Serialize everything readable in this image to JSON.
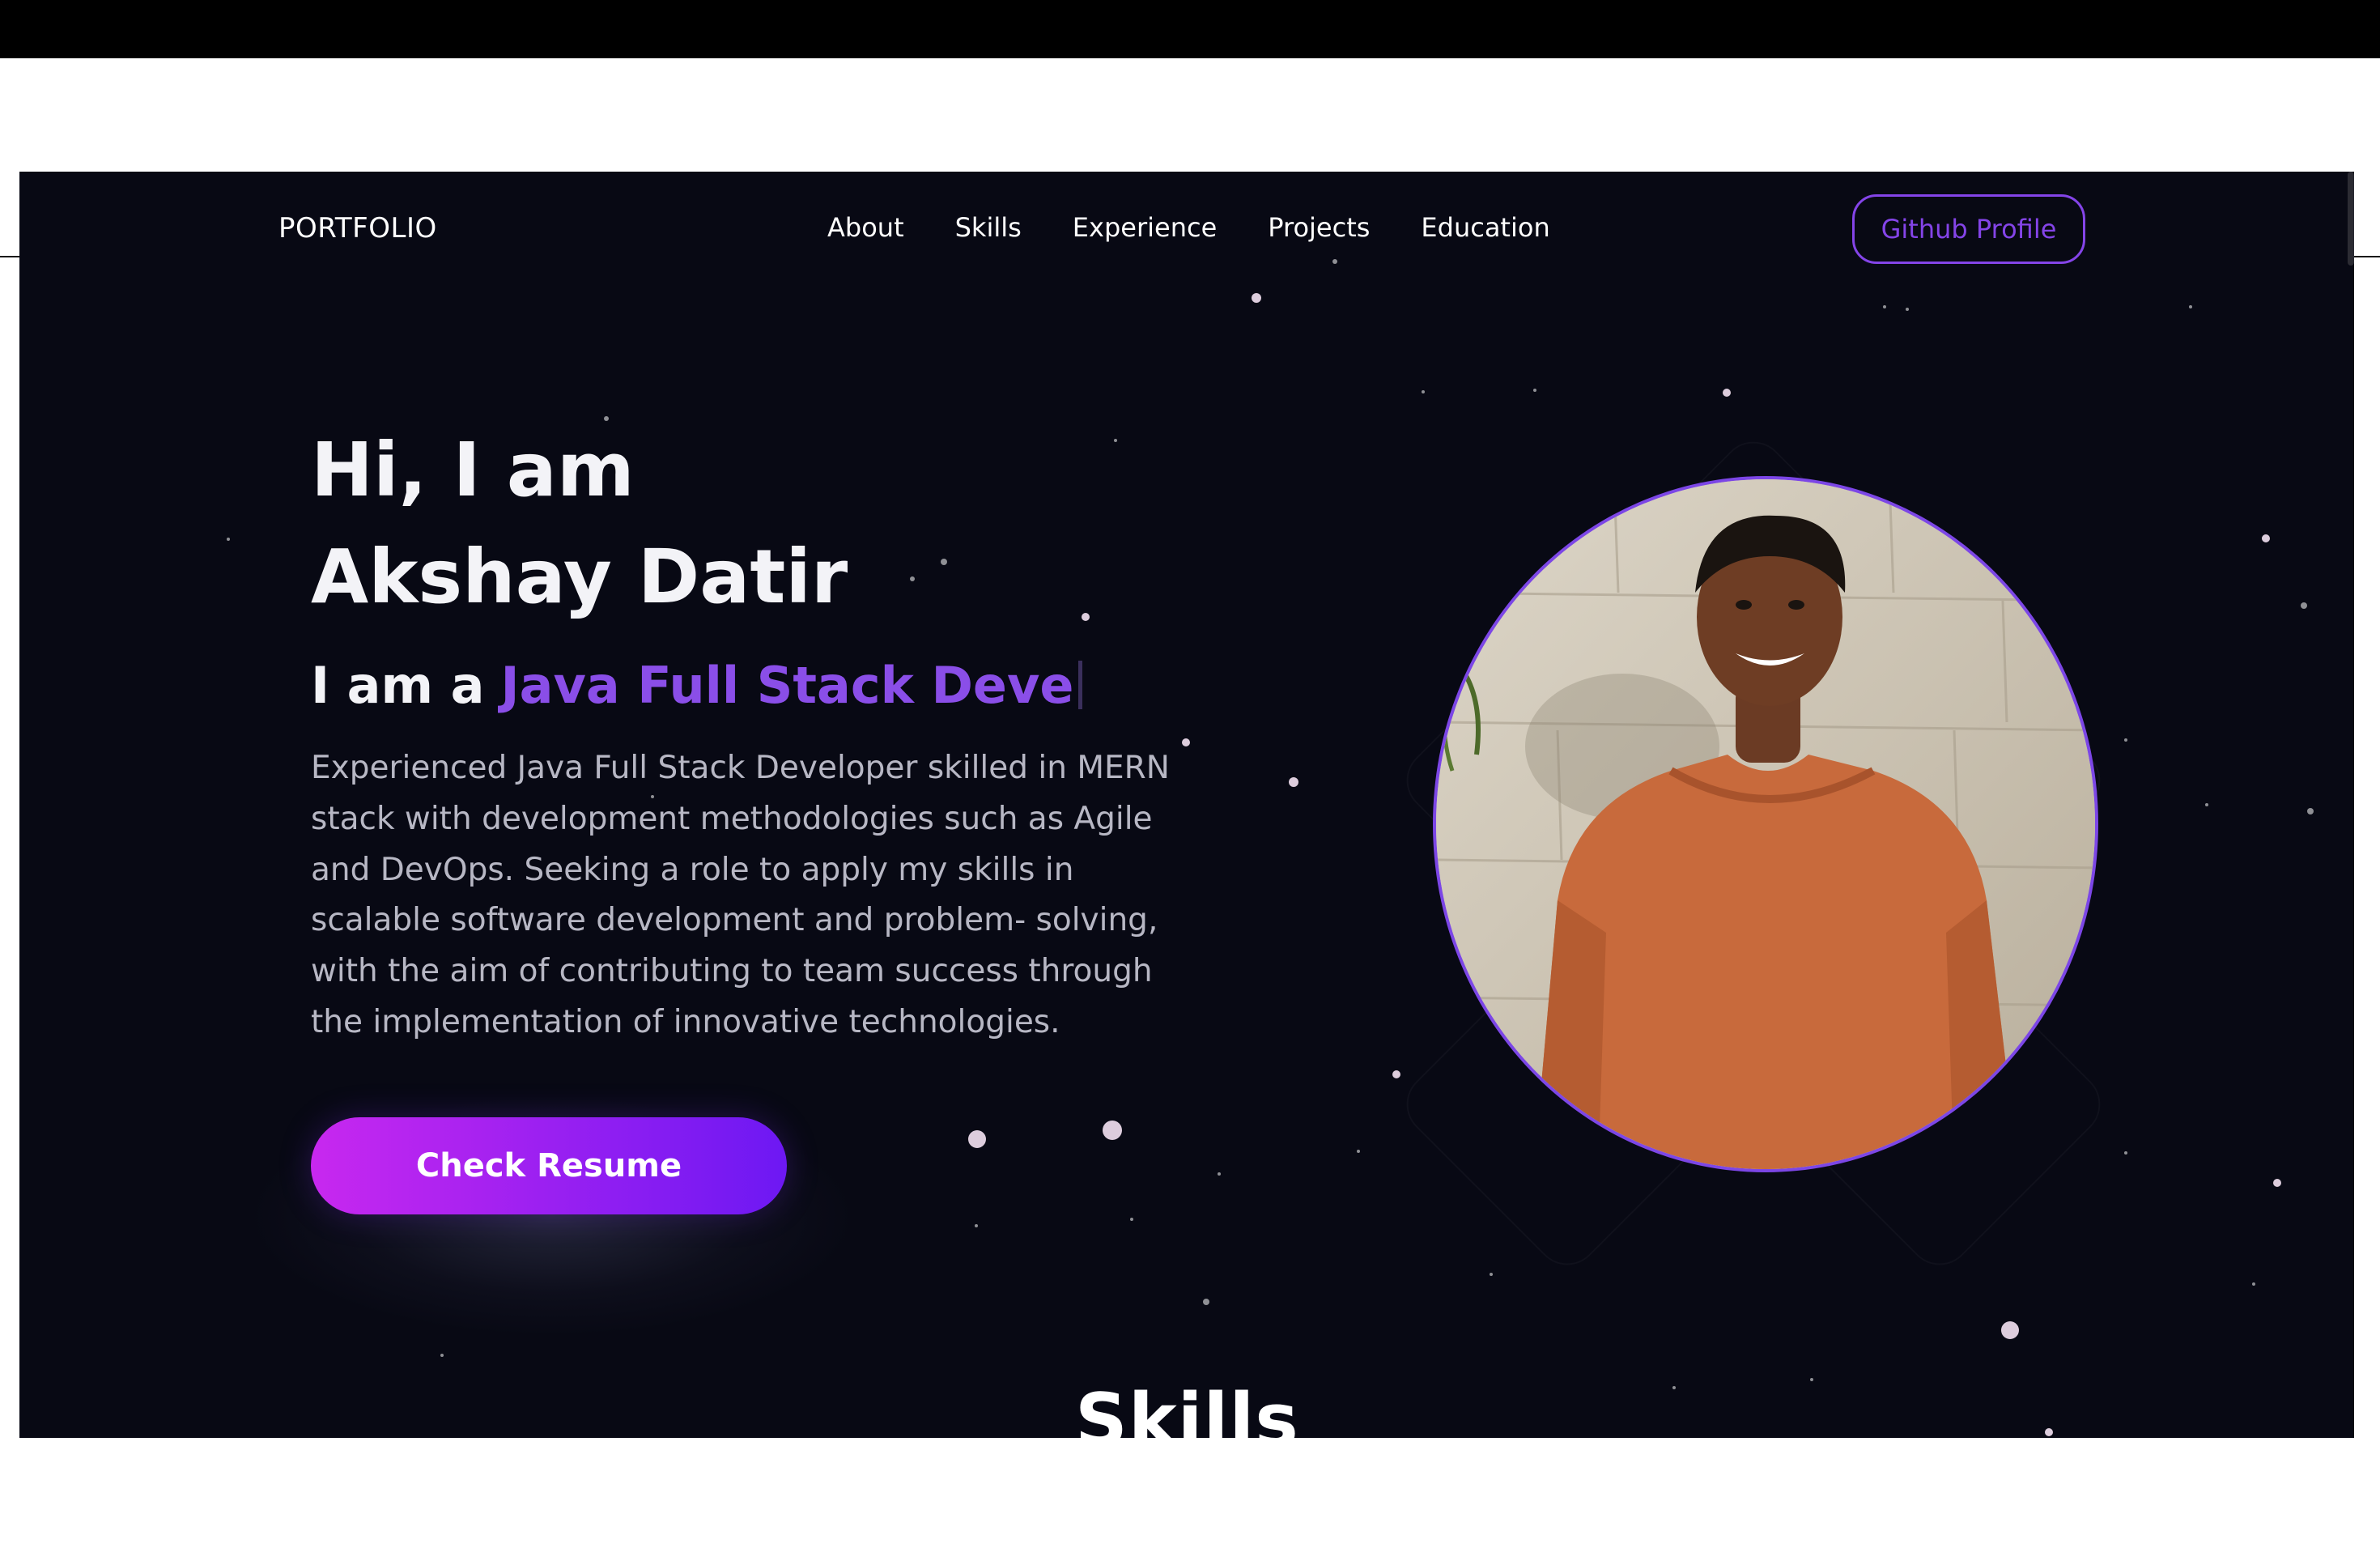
{
  "nav": {
    "brand": "PORTFOLIO",
    "links": [
      "About",
      "Skills",
      "Experience",
      "Projects",
      "Education"
    ],
    "cta": "Github Profile"
  },
  "hero": {
    "greeting": "Hi, I am",
    "name": "Akshay Datir",
    "role_prefix": "I am a",
    "role_typed": "Java Full Stack Deve",
    "description": "Experienced Java Full Stack Developer skilled in MERN stack with development methodologies such as Agile and DevOps. Seeking a role to apply my skills in scalable software development and problem- solving, with the aim of contributing to team success through the implementation of innovative technologies.",
    "button": "Check Resume"
  },
  "sections": {
    "next_heading": "Skills"
  },
  "colors": {
    "background": "#080914",
    "accent": "#8a4ee8",
    "button_gradient_start": "#c828ef",
    "button_gradient_end": "#6d18f3",
    "text_muted": "#b7b7c4"
  },
  "icons": {
    "profile_photo": "profile-photo"
  }
}
